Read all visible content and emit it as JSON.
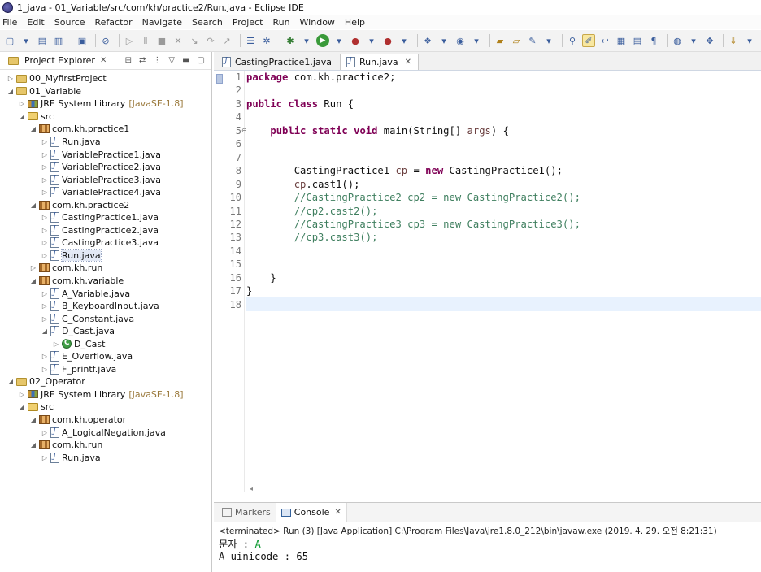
{
  "window": {
    "title": "1_java - 01_Variable/src/com/kh/practice2/Run.java - Eclipse IDE"
  },
  "menu": [
    "File",
    "Edit",
    "Source",
    "Refactor",
    "Navigate",
    "Search",
    "Project",
    "Run",
    "Window",
    "Help"
  ],
  "explorer": {
    "title": "Project Explorer",
    "tree": [
      {
        "depth": 0,
        "twisty": "▷",
        "icon": "project",
        "label": "00_MyfirstProject"
      },
      {
        "depth": 0,
        "twisty": "◢",
        "icon": "project",
        "label": "01_Variable"
      },
      {
        "depth": 1,
        "twisty": "▷",
        "icon": "lib",
        "label": "JRE System Library",
        "extra": "[JavaSE-1.8]"
      },
      {
        "depth": 1,
        "twisty": "◢",
        "icon": "src",
        "label": "src"
      },
      {
        "depth": 2,
        "twisty": "◢",
        "icon": "pkg",
        "label": "com.kh.practice1"
      },
      {
        "depth": 3,
        "twisty": "▷",
        "icon": "java",
        "label": "Run.java"
      },
      {
        "depth": 3,
        "twisty": "▷",
        "icon": "java",
        "label": "VariablePractice1.java"
      },
      {
        "depth": 3,
        "twisty": "▷",
        "icon": "java",
        "label": "VariablePractice2.java"
      },
      {
        "depth": 3,
        "twisty": "▷",
        "icon": "java",
        "label": "VariablePractice3.java"
      },
      {
        "depth": 3,
        "twisty": "▷",
        "icon": "java",
        "label": "VariablePractice4.java"
      },
      {
        "depth": 2,
        "twisty": "◢",
        "icon": "pkg",
        "label": "com.kh.practice2"
      },
      {
        "depth": 3,
        "twisty": "▷",
        "icon": "java",
        "label": "CastingPractice1.java"
      },
      {
        "depth": 3,
        "twisty": "▷",
        "icon": "java",
        "label": "CastingPractice2.java"
      },
      {
        "depth": 3,
        "twisty": "▷",
        "icon": "java",
        "label": "CastingPractice3.java"
      },
      {
        "depth": 3,
        "twisty": "▷",
        "icon": "java",
        "label": "Run.java",
        "selected": true
      },
      {
        "depth": 2,
        "twisty": "▷",
        "icon": "pkg",
        "label": "com.kh.run"
      },
      {
        "depth": 2,
        "twisty": "◢",
        "icon": "pkg",
        "label": "com.kh.variable"
      },
      {
        "depth": 3,
        "twisty": "▷",
        "icon": "java",
        "label": "A_Variable.java"
      },
      {
        "depth": 3,
        "twisty": "▷",
        "icon": "java",
        "label": "B_KeyboardInput.java"
      },
      {
        "depth": 3,
        "twisty": "▷",
        "icon": "java",
        "label": "C_Constant.java"
      },
      {
        "depth": 3,
        "twisty": "◢",
        "icon": "java",
        "label": "D_Cast.java"
      },
      {
        "depth": 4,
        "twisty": "▷",
        "icon": "class",
        "label": "D_Cast"
      },
      {
        "depth": 3,
        "twisty": "▷",
        "icon": "java",
        "label": "E_Overflow.java"
      },
      {
        "depth": 3,
        "twisty": "▷",
        "icon": "java",
        "label": "F_printf.java"
      },
      {
        "depth": 0,
        "twisty": "◢",
        "icon": "project",
        "label": "02_Operator"
      },
      {
        "depth": 1,
        "twisty": "▷",
        "icon": "lib",
        "label": "JRE System Library",
        "extra": "[JavaSE-1.8]"
      },
      {
        "depth": 1,
        "twisty": "◢",
        "icon": "src",
        "label": "src"
      },
      {
        "depth": 2,
        "twisty": "◢",
        "icon": "pkg",
        "label": "com.kh.operator"
      },
      {
        "depth": 3,
        "twisty": "▷",
        "icon": "java",
        "label": "A_LogicalNegation.java"
      },
      {
        "depth": 2,
        "twisty": "◢",
        "icon": "pkg",
        "label": "com.kh.run"
      },
      {
        "depth": 3,
        "twisty": "▷",
        "icon": "java",
        "label": "Run.java"
      }
    ]
  },
  "editor": {
    "tabs": [
      {
        "label": "CastingPractice1.java",
        "active": false
      },
      {
        "label": "Run.java",
        "active": true
      }
    ],
    "lines": [
      {
        "n": "1",
        "tokens": [
          {
            "t": "package",
            "c": "kw"
          },
          {
            "t": " com.kh.practice2;"
          }
        ]
      },
      {
        "n": "2",
        "tokens": []
      },
      {
        "n": "3",
        "tokens": [
          {
            "t": "public",
            "c": "kw"
          },
          {
            "t": " "
          },
          {
            "t": "class",
            "c": "kw"
          },
          {
            "t": " Run {"
          }
        ]
      },
      {
        "n": "4",
        "tokens": []
      },
      {
        "n": "5",
        "fold": true,
        "tokens": [
          {
            "t": "    "
          },
          {
            "t": "public",
            "c": "kw"
          },
          {
            "t": " "
          },
          {
            "t": "static",
            "c": "kw"
          },
          {
            "t": " "
          },
          {
            "t": "void",
            "c": "kw"
          },
          {
            "t": " main(String[] "
          },
          {
            "t": "args",
            "c": "var"
          },
          {
            "t": ") {"
          }
        ]
      },
      {
        "n": "6",
        "tokens": []
      },
      {
        "n": "7",
        "tokens": []
      },
      {
        "n": "8",
        "tokens": [
          {
            "t": "        CastingPractice1 "
          },
          {
            "t": "cp",
            "c": "var"
          },
          {
            "t": " = "
          },
          {
            "t": "new",
            "c": "kw"
          },
          {
            "t": " CastingPractice1();"
          }
        ]
      },
      {
        "n": "9",
        "tokens": [
          {
            "t": "        "
          },
          {
            "t": "cp",
            "c": "var"
          },
          {
            "t": ".cast1();"
          }
        ]
      },
      {
        "n": "10",
        "tokens": [
          {
            "t": "        "
          },
          {
            "t": "//CastingPractice2 cp2 = new CastingPractice2();",
            "c": "cm"
          }
        ]
      },
      {
        "n": "11",
        "tokens": [
          {
            "t": "        "
          },
          {
            "t": "//cp2.cast2();",
            "c": "cm"
          }
        ]
      },
      {
        "n": "12",
        "tokens": [
          {
            "t": "        "
          },
          {
            "t": "//CastingPractice3 cp3 = new CastingPractice3();",
            "c": "cm"
          }
        ]
      },
      {
        "n": "13",
        "tokens": [
          {
            "t": "        "
          },
          {
            "t": "//cp3.cast3();",
            "c": "cm"
          }
        ]
      },
      {
        "n": "14",
        "tokens": []
      },
      {
        "n": "15",
        "tokens": []
      },
      {
        "n": "16",
        "tokens": [
          {
            "t": "    }"
          }
        ]
      },
      {
        "n": "17",
        "tokens": [
          {
            "t": "}"
          }
        ]
      },
      {
        "n": "18",
        "current": true,
        "tokens": []
      }
    ]
  },
  "bottom": {
    "tabs": [
      {
        "label": "Markers",
        "active": false
      },
      {
        "label": "Console",
        "active": true
      }
    ],
    "terminated": "<terminated> Run (3) [Java Application] C:\\Program Files\\Java\\jre1.8.0_212\\bin\\javaw.exe (2019. 4. 29. 오전 8:21:31)",
    "output": [
      {
        "prefix": "문자 : ",
        "input": "A"
      },
      {
        "prefix": "A uinicode : 65",
        "input": ""
      }
    ]
  },
  "colors": {
    "keyword": "#7f0055",
    "comment": "#3f7f5f",
    "local_var": "#6a3e3e",
    "stdin": "#0a9a2f",
    "current_line": "#e8f2fe"
  }
}
